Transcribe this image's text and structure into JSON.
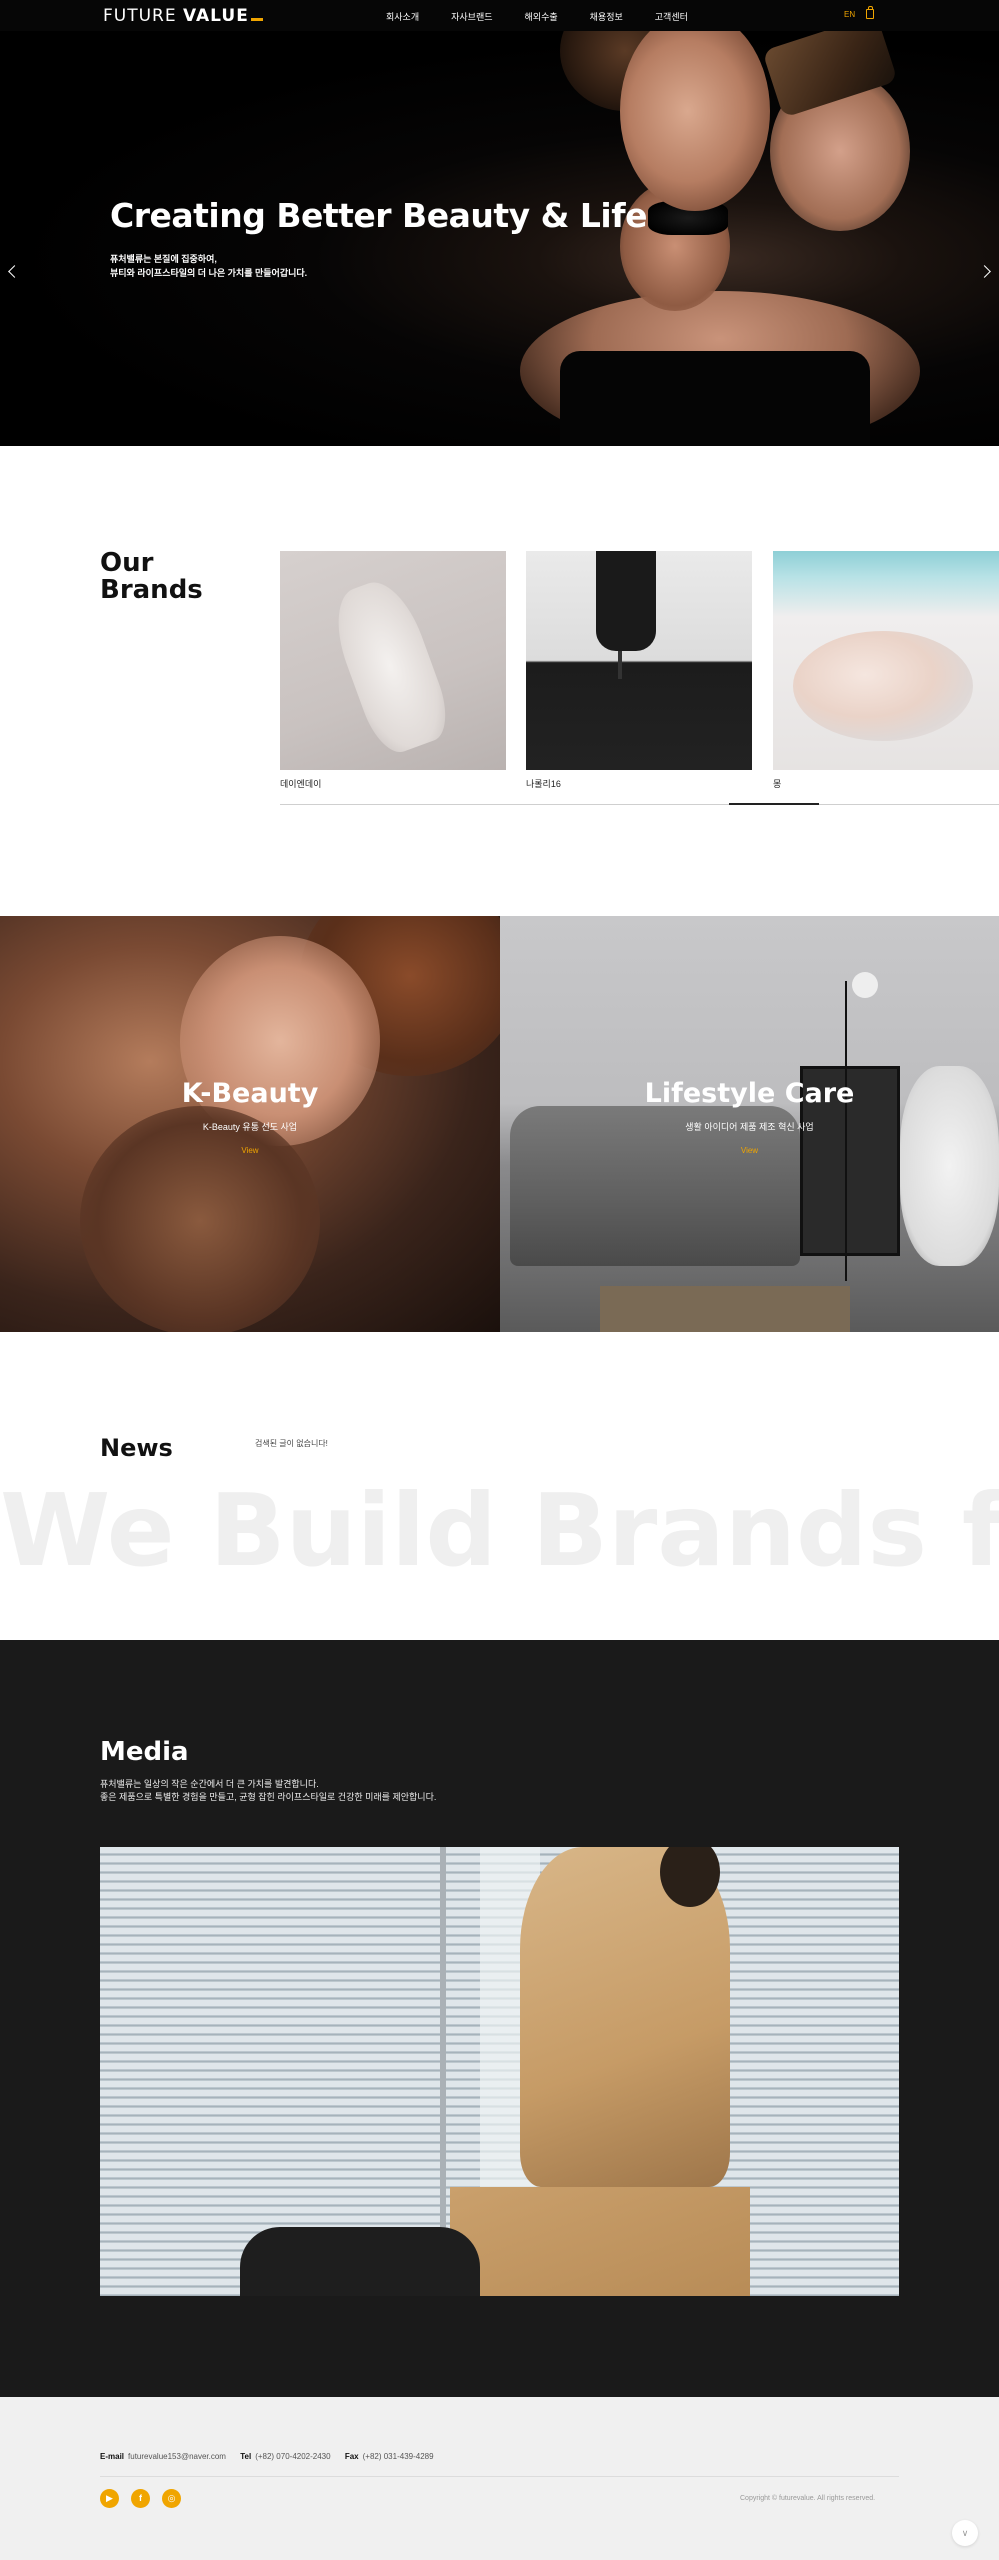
{
  "header": {
    "logo_light": "FUTURE",
    "logo_bold": "VALUE",
    "nav": [
      "회사소개",
      "자사브랜드",
      "해외수출",
      "채용정보",
      "고객센터"
    ],
    "lang": "EN",
    "cart_icon": "shopping-bag-icon"
  },
  "hero": {
    "title": "Creating Better Beauty & Life",
    "subtitle_line1": "퓨처밸류는 본질에 집중하여,",
    "subtitle_line2": "뷰티와 라이프스타일의 더 나은 가치를 만들어갑니다.",
    "prev_icon": "chevron-left-icon",
    "next_icon": "chevron-right-icon"
  },
  "brands": {
    "title_line1": "Our",
    "title_line2": "Brands",
    "items": [
      {
        "label": "데이엔데이"
      },
      {
        "label": "나롤리16"
      },
      {
        "label": "몽"
      }
    ]
  },
  "categories": [
    {
      "title": "K-Beauty",
      "subtitle": "K-Beauty 유통 선도 사업",
      "link": "View"
    },
    {
      "title": "Lifestyle Care",
      "subtitle": "생활 아이디어 제품 제조 혁신 사업",
      "link": "View"
    }
  ],
  "news": {
    "title": "News",
    "empty_message": "검색된 글이 없습니다!",
    "marquee": "We Build Brands for"
  },
  "media": {
    "title": "Media",
    "desc_line1": "퓨처밸류는 일상의 작은 순간에서 더 큰 가치를 발견합니다.",
    "desc_line2": "좋은 제품으로 특별한 경험을 만들고, 균형 잡힌 라이프스타일로 건강한 미래를 제안합니다."
  },
  "footer": {
    "email_label": "E-mail",
    "email": "futurevalue153@naver.com",
    "tel_label": "Tel",
    "tel": "(+82) 070-4202-2430",
    "fax_label": "Fax",
    "fax": "(+82) 031-439-4289",
    "social": [
      {
        "icon": "youtube-icon",
        "glyph": "▶"
      },
      {
        "icon": "facebook-icon",
        "glyph": "f"
      },
      {
        "icon": "instagram-icon",
        "glyph": "◎"
      }
    ],
    "copyright": "Copyright © futurevalue. All rights reserved.",
    "top_label": "∨"
  },
  "colors": {
    "accent": "#f0a500",
    "header_bg": "#060606",
    "media_bg": "#1a1a1a",
    "footer_bg": "#f0f0f0"
  }
}
